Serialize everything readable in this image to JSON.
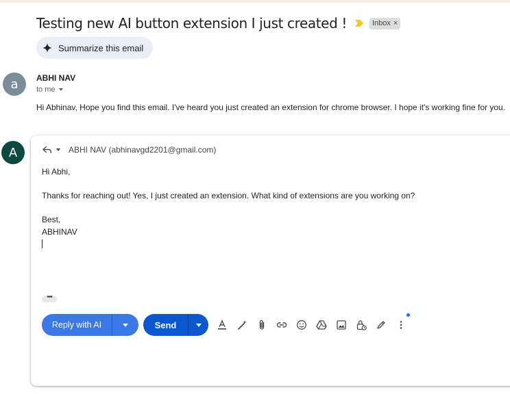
{
  "thread": {
    "subject": "Testing new AI button extension I just created !",
    "label": "Inbox",
    "label_remove": "×",
    "summarize_label": "Summarize this email"
  },
  "message": {
    "avatar_letter": "a",
    "sender": "ABHI NAV",
    "to_line": "to me",
    "body": "Hi Abhinav, Hope you find this email. I've heard you just created an extension for chrome browser. I hope it's working fine for you."
  },
  "reply": {
    "avatar_letter": "A",
    "recipient": "ABHI NAV (abhinavgd2201@gmail.com)",
    "lines": [
      "Hi Abhi,",
      "Thanks for reaching out! Yes, I just created an extension. What kind of extensions are you working on?",
      "Best,",
      "ABHINAV"
    ],
    "ellipsis": "•••",
    "ai_button_label": "Reply with AI",
    "send_label": "Send"
  },
  "toolbar_icons": [
    "text-format-icon",
    "ai-write-icon",
    "attach-icon",
    "link-icon",
    "emoji-icon",
    "drive-icon",
    "photo-icon",
    "confidential-mode-icon",
    "signature-icon",
    "more-options-icon"
  ],
  "colors": {
    "primary_blue": "#0b57d0",
    "ai_button_blue": "#3b78e7",
    "chip_bg": "#e9eef6",
    "sender_avatar": "#7a8e9a",
    "reply_avatar": "#0b4b3f",
    "important_marker": "#f5c518"
  }
}
